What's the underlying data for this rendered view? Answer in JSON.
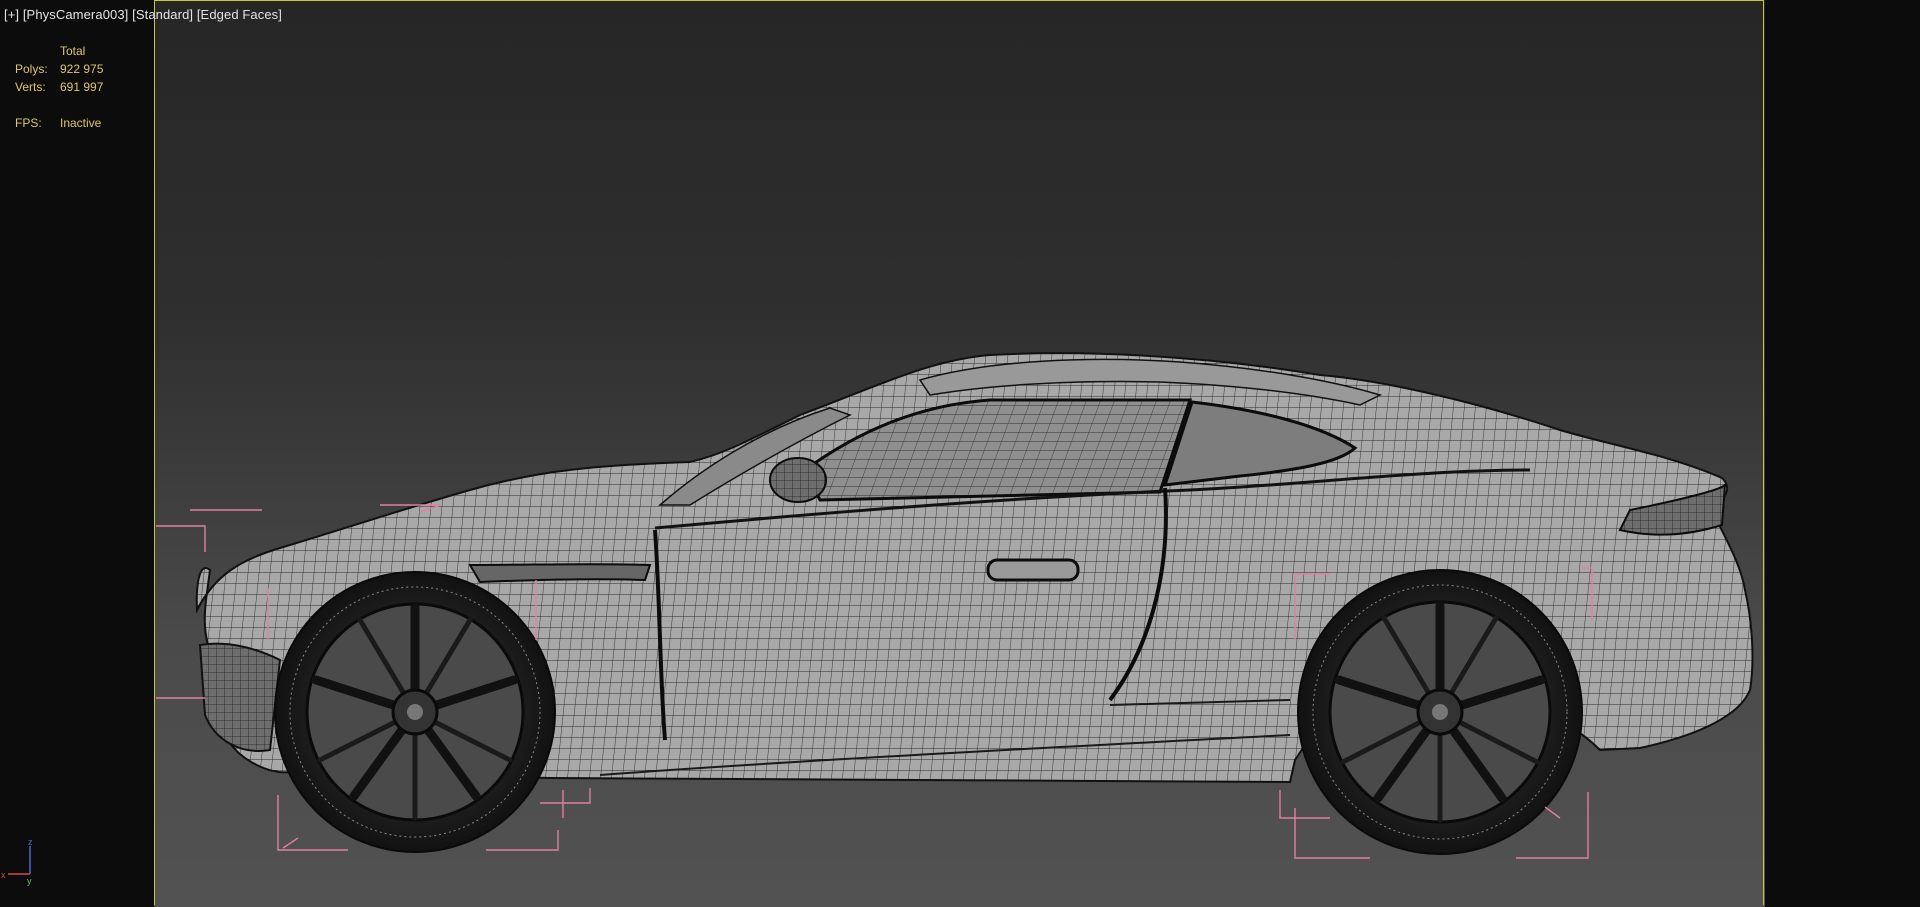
{
  "viewport": {
    "label_plus": "[+]",
    "label_camera": "[PhysCamera003]",
    "label_shading": "[Standard]",
    "label_mode": "[Edged Faces]"
  },
  "stats": {
    "total_header": "Total",
    "polys_label": "Polys:",
    "polys_value": "922 975",
    "verts_label": "Verts:",
    "verts_value": "691 997",
    "fps_label": "FPS:",
    "fps_value": "Inactive"
  },
  "axis": {
    "x": "x",
    "y": "y",
    "z": "z"
  },
  "colors": {
    "frame": "#c8c83a",
    "stats_text": "#e0c66a",
    "bbox_brackets": "#e07fa0",
    "viewport_top": "#262626",
    "viewport_bottom": "#525252"
  }
}
